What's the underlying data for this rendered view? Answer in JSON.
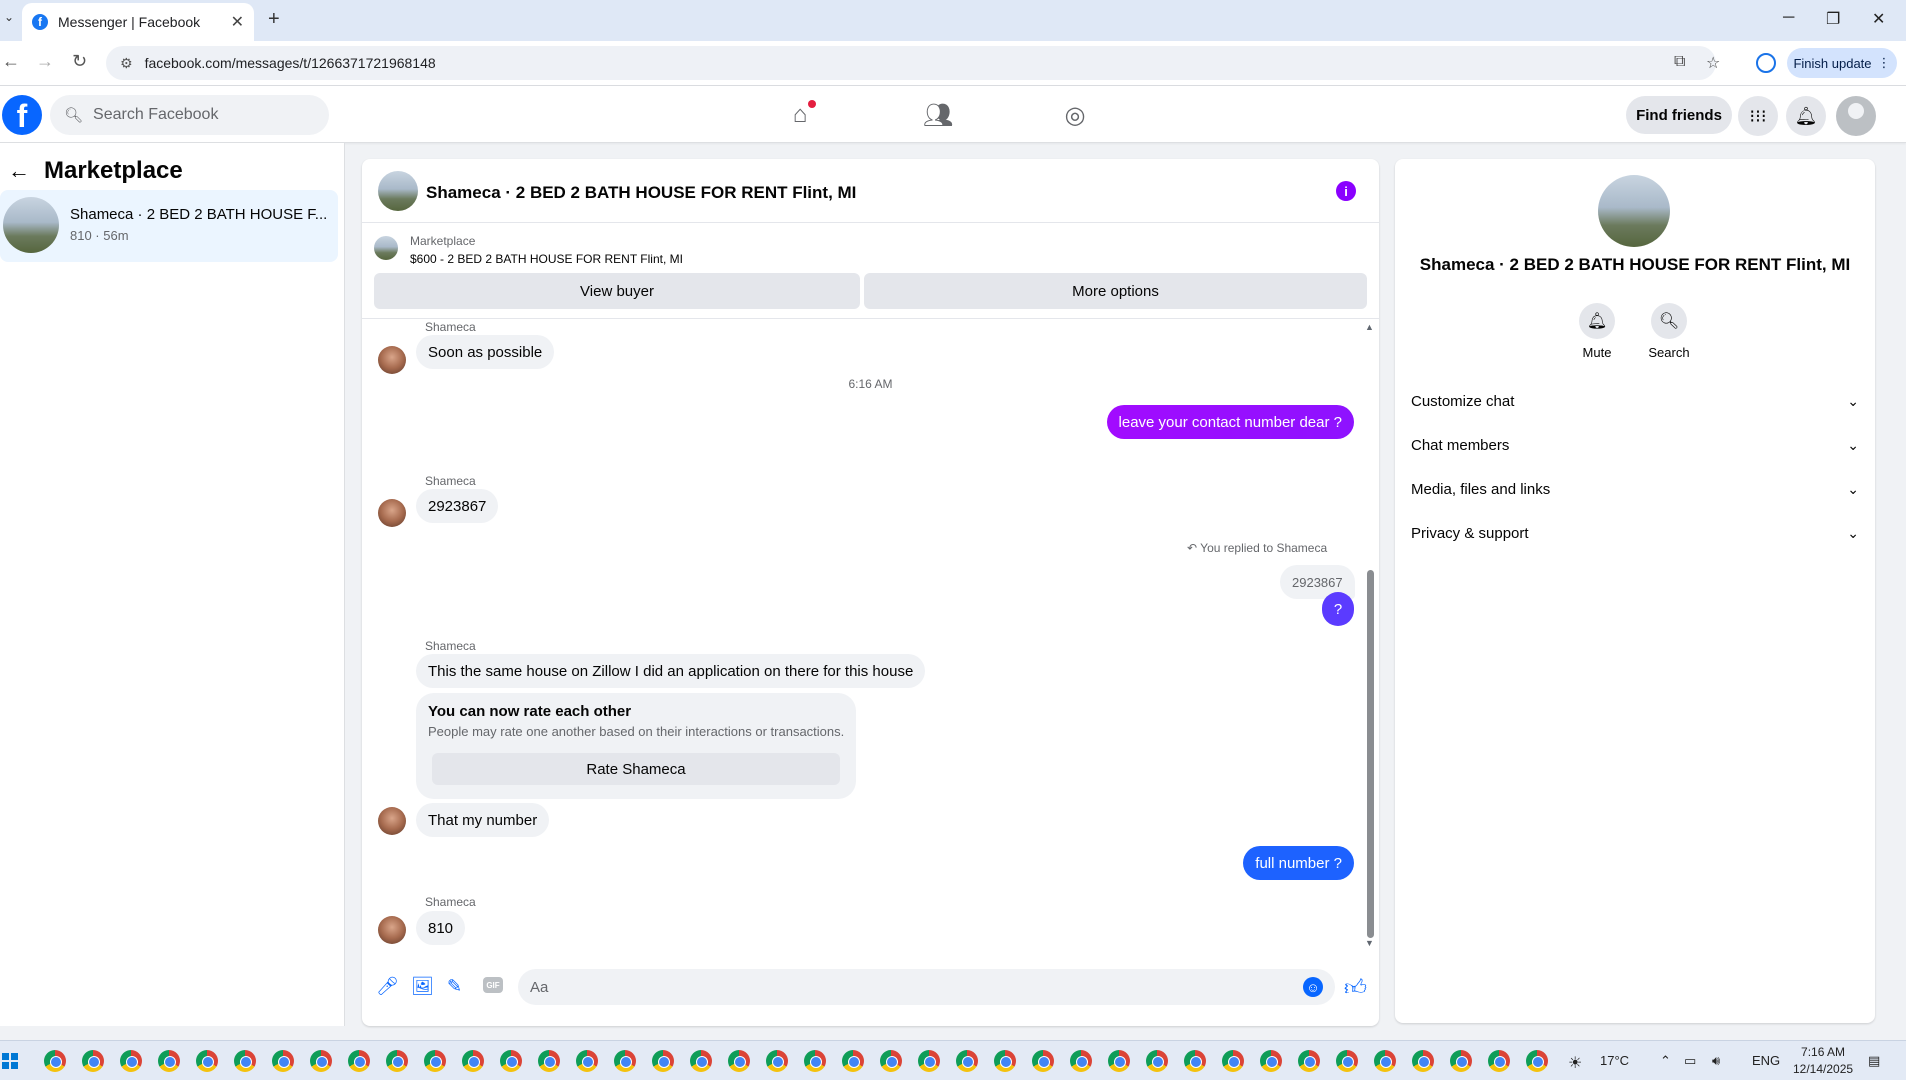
{
  "browser": {
    "tab_title": "Messenger | Facebook",
    "url": "facebook.com/messages/t/1266371721968148",
    "finish_update": "Finish update"
  },
  "fb": {
    "search_placeholder": "Search Facebook",
    "find_friends": "Find friends"
  },
  "left": {
    "heading": "Marketplace",
    "conversation": {
      "title": "Shameca · 2 BED 2 BATH HOUSE F...",
      "subtitle": "810 · 56m"
    }
  },
  "chat": {
    "header_title": "Shameca · 2 BED 2 BATH HOUSE FOR RENT Flint, MI",
    "marketplace_label": "Marketplace",
    "listing": "$600 - 2 BED 2 BATH HOUSE FOR RENT Flint, MI",
    "view_buyer": "View buyer",
    "more_options": "More options",
    "messages": {
      "m1_sender": "Shameca",
      "m1_text": "Soon as possible",
      "timestamp": "6:16 AM",
      "m2_text": "leave your contact number dear ?",
      "m3_sender": "Shameca",
      "m3_text": "2923867",
      "reply_note": "You replied to Shameca",
      "reply_quote": "2923867",
      "m4_text": "?",
      "m5_sender": "Shameca",
      "m5_text": "This the same house on Zillow I did an application on there for this house",
      "rate_title": "You can now rate each other",
      "rate_sub": "People may rate one another based on their interactions or transactions.",
      "rate_button": "Rate Shameca",
      "m6_text": "That my number",
      "m7_text": "full number ?",
      "m8_sender": "Shameca",
      "m8_text": "810"
    },
    "composer_placeholder": "Aa"
  },
  "right": {
    "title": "Shameca · 2 BED 2 BATH HOUSE FOR RENT Flint, MI",
    "mute": "Mute",
    "search": "Search",
    "sections": [
      "Customize chat",
      "Chat members",
      "Media, files and links",
      "Privacy & support"
    ]
  },
  "taskbar": {
    "temperature": "17°C",
    "language": "ENG",
    "time": "7:16 AM",
    "date": "12/14/2025"
  },
  "colors": {
    "fb_blue": "#0866ff",
    "messenger_purple": "#8a00ff",
    "outgoing_gradient_1": "#a20bff",
    "outgoing_gradient_2": "#5b3bff",
    "outgoing_blue": "#1d62ff"
  }
}
